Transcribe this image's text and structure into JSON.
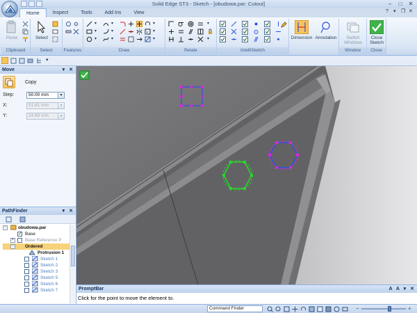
{
  "window": {
    "title": "Solid Edge ST3 - Sketch - [obudowa.par: Cutout]"
  },
  "tabs": [
    {
      "label": "Home",
      "active": true
    },
    {
      "label": "Inspect",
      "active": false
    },
    {
      "label": "Tools",
      "active": false
    },
    {
      "label": "Add Ins",
      "active": false
    },
    {
      "label": "View",
      "active": false
    }
  ],
  "ribbon": {
    "clipboard": {
      "label": "Clipboard",
      "paste": "Paste"
    },
    "select": {
      "label": "Select",
      "select": "Select"
    },
    "features": {
      "label": "Features"
    },
    "draw": {
      "label": "Draw"
    },
    "relate": {
      "label": "Relate"
    },
    "intellisketch": {
      "label": "IntelliSketch"
    },
    "dimension": {
      "dimension": "Dimension",
      "annotation": "Annotation"
    },
    "window": {
      "label": "Window",
      "switch": "Switch Windows"
    },
    "close": {
      "label": "Close",
      "close_sketch": "Close Sketch"
    }
  },
  "move_panel": {
    "title": "Move",
    "copy_label": "Copy",
    "step_label": "Step:",
    "step_value": "50.00 mm",
    "x_label": "X:",
    "x_value": "51.81 mm",
    "y_label": "Y:",
    "y_value": "24.69 mm"
  },
  "pathfinder": {
    "title": "PathFinder",
    "nodes": {
      "root": "obudowa.par",
      "base": "Base",
      "base_ref": "Base Reference P",
      "ordered": "Ordered",
      "protrusion": "Protrusion 1",
      "sketch1": "Sketch 1",
      "sketch2": "Sketch 2",
      "sketch3": "Sketch 3",
      "sketch5": "Sketch 5",
      "sketch6": "Sketch 6",
      "sketch7": "Sketch 7"
    }
  },
  "promptbar": {
    "title": "PromptBar",
    "text": "Click for the point to move the element to."
  },
  "statusbar": {
    "command_finder": "Command Finder"
  },
  "colors": {
    "accent": "#f6c35a",
    "ribbon_border": "#8db2e3",
    "viewport_bg": "#6e6e70",
    "sketch_green": "#28d628",
    "sketch_blue": "#2f4fe6",
    "sketch_magenta": "#d62ad6"
  }
}
